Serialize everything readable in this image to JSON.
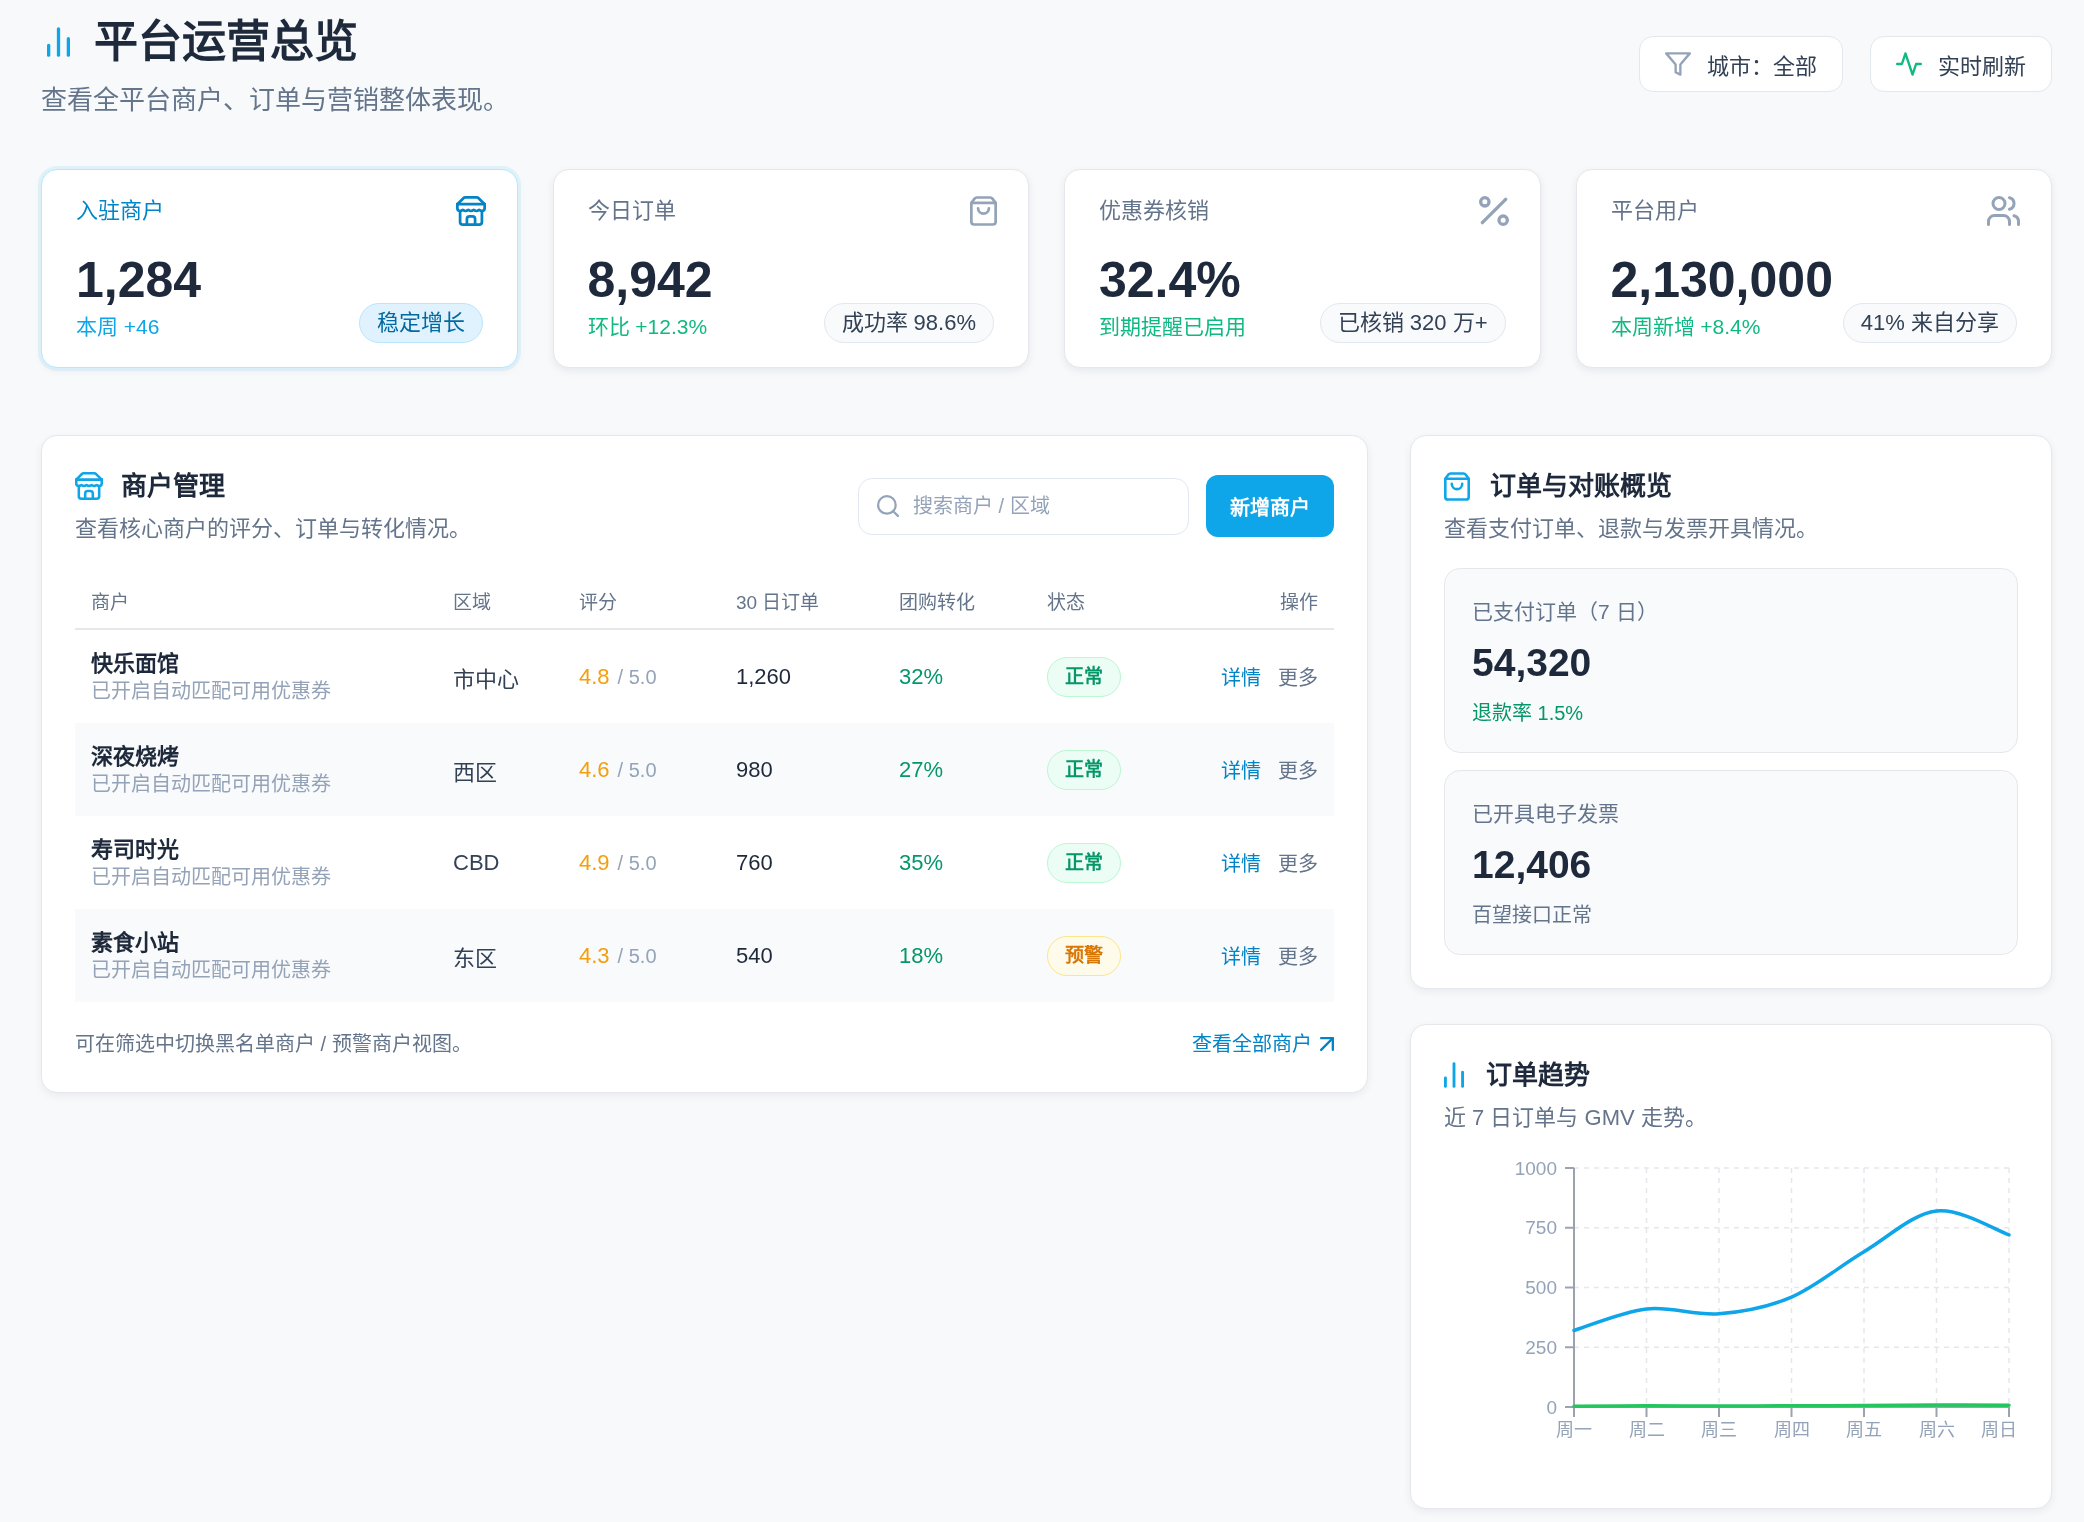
{
  "header": {
    "title": "平台运营总览",
    "subtitle": "查看全平台商户、订单与营销整体表现。",
    "actions": [
      {
        "label": "城市：全部"
      },
      {
        "label": "实时刷新"
      }
    ]
  },
  "stats": [
    {
      "label": "入驻商户",
      "value": "1,284",
      "note": "本周 +46",
      "badge": "稳定增长",
      "highlighted": true
    },
    {
      "label": "今日订单",
      "value": "8,942",
      "note": "环比 +12.3%",
      "badge": "成功率 98.6%",
      "highlighted": false
    },
    {
      "label": "优惠券核销",
      "value": "32.4%",
      "note": "到期提醒已启用",
      "badge": "已核销 320 万+",
      "highlighted": false
    },
    {
      "label": "平台用户",
      "value": "2,130,000",
      "note": "本周新增 +8.4%",
      "badge": "41% 来自分享",
      "highlighted": false
    }
  ],
  "merchants": {
    "title": "商户管理",
    "subtitle": "查看核心商户的评分、订单与转化情况。",
    "search": {
      "placeholder": "搜索商户 / 区域"
    },
    "add_button": "新增商户",
    "table": {
      "columns": [
        "商户",
        "区域",
        "评分",
        "30 日订单",
        "团购转化",
        "状态",
        "操作"
      ],
      "rows": [
        {
          "name": "快乐面馆",
          "note": "已开启自动匹配可用优惠券",
          "region": "市中心",
          "rating": "4.8",
          "rating_scale": "/ 5.0",
          "orders": "1,260",
          "conversion": "32%",
          "status": {
            "label": "正常",
            "kind": "normal"
          },
          "actions": [
            "详情",
            "更多"
          ]
        },
        {
          "name": "深夜烧烤",
          "note": "已开启自动匹配可用优惠券",
          "region": "西区",
          "rating": "4.6",
          "rating_scale": "/ 5.0",
          "orders": "980",
          "conversion": "27%",
          "status": {
            "label": "正常",
            "kind": "normal"
          },
          "actions": [
            "详情",
            "更多"
          ]
        },
        {
          "name": "寿司时光",
          "note": "已开启自动匹配可用优惠券",
          "region": "CBD",
          "rating": "4.9",
          "rating_scale": "/ 5.0",
          "orders": "760",
          "conversion": "35%",
          "status": {
            "label": "正常",
            "kind": "normal"
          },
          "actions": [
            "详情",
            "更多"
          ]
        },
        {
          "name": "素食小站",
          "note": "已开启自动匹配可用优惠券",
          "region": "东区",
          "rating": "4.3",
          "rating_scale": "/ 5.0",
          "orders": "540",
          "conversion": "18%",
          "status": {
            "label": "预警",
            "kind": "warning"
          },
          "actions": [
            "详情",
            "更多"
          ]
        }
      ]
    },
    "footer": {
      "text": "可在筛选中切换黑名单商户 / 预警商户视图。",
      "link": "查看全部商户"
    }
  },
  "reconciliation": {
    "title": "订单与对账概览",
    "subtitle": "查看支付订单、退款与发票开具情况。",
    "metrics": [
      {
        "label": "已支付订单（7 日）",
        "value": "54,320",
        "note": "退款率 1.5%",
        "kind": "positive"
      },
      {
        "label": "已开具电子发票",
        "value": "12,406",
        "note": "百望接口正常",
        "kind": "neutral"
      }
    ]
  },
  "trend": {
    "title": "订单趋势",
    "subtitle": "近 7 日订单与 GMV 走势。",
    "chart_data": {
      "type": "line",
      "categories": [
        "周一",
        "周二",
        "周三",
        "周四",
        "周五",
        "周六",
        "周日"
      ],
      "series": [
        {
          "color": "#0ea5e9",
          "values": [
            320,
            410,
            390,
            460,
            650,
            820,
            720
          ]
        },
        {
          "color": "#22c55e",
          "values": [
            3,
            5,
            4,
            5,
            6,
            8,
            7
          ]
        }
      ],
      "ylim": [
        0,
        1000
      ],
      "yticks": [
        0,
        250,
        500,
        750,
        1000
      ],
      "grid": true
    }
  }
}
